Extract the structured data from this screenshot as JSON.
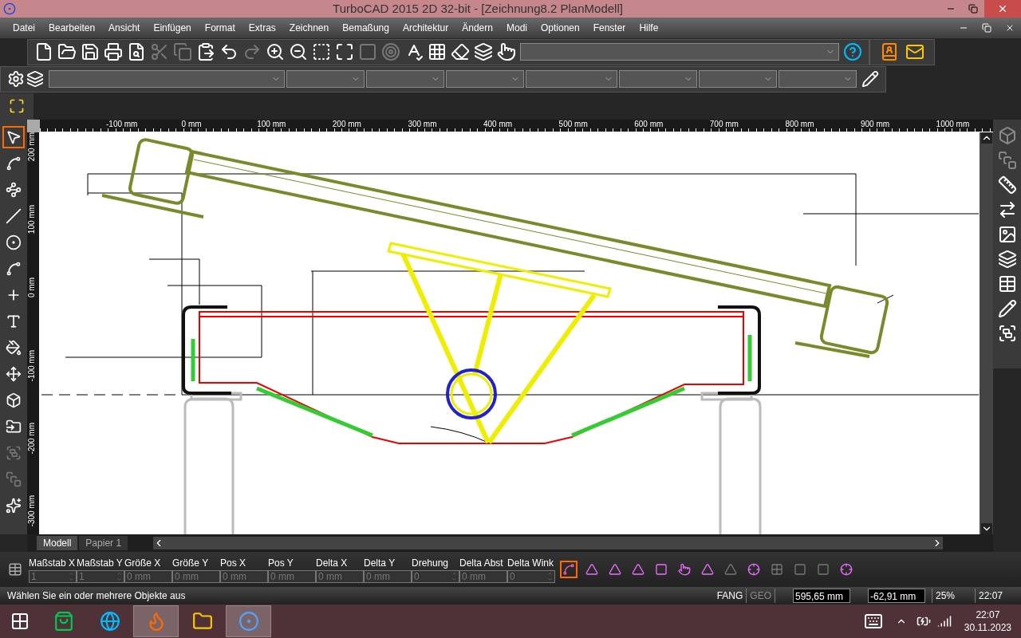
{
  "window": {
    "title": "TurboCAD 2015 2D 32-bit - [Zeichnung8.2 PlanModell]"
  },
  "menu": [
    "Datei",
    "Bearbeiten",
    "Ansicht",
    "Einfügen",
    "Format",
    "Extras",
    "Zeichnen",
    "Bemaßung",
    "Architektur",
    "Ändern",
    "Modi",
    "Optionen",
    "Fenster",
    "Hilfe"
  ],
  "toolbar": {
    "buttons": [
      {
        "disabled": false
      },
      {
        "disabled": false
      },
      {
        "disabled": false
      },
      {
        "disabled": false
      },
      {
        "disabled": false
      },
      {
        "disabled": true
      },
      {
        "disabled": true
      },
      {
        "disabled": false
      },
      {
        "disabled": false
      },
      {
        "disabled": true
      },
      {
        "disabled": false
      },
      {
        "disabled": false
      },
      {
        "disabled": false
      },
      {
        "disabled": false
      },
      {
        "disabled": true
      },
      {
        "disabled": true
      },
      {
        "disabled": false
      },
      {
        "disabled": false
      },
      {
        "disabled": false
      },
      {
        "disabled": false
      },
      {
        "disabled": false
      }
    ]
  },
  "tools": [
    {
      "selected": true,
      "disabled": false
    },
    {
      "selected": false,
      "disabled": false
    },
    {
      "selected": false,
      "disabled": false
    },
    {
      "selected": false,
      "disabled": false
    },
    {
      "selected": false,
      "disabled": false
    },
    {
      "selected": false,
      "disabled": false
    },
    {
      "selected": false,
      "disabled": false
    },
    {
      "selected": false,
      "disabled": false
    },
    {
      "selected": false,
      "disabled": false
    },
    {
      "selected": false,
      "disabled": false
    },
    {
      "selected": false,
      "disabled": false
    },
    {
      "selected": false,
      "disabled": false
    },
    {
      "selected": false,
      "disabled": true
    },
    {
      "selected": false,
      "disabled": true
    },
    {
      "selected": false,
      "disabled": false
    }
  ],
  "ruler_x": [
    "-100 mm",
    "0 mm",
    "100 mm",
    "200 mm",
    "300 mm",
    "400 mm",
    "500 mm",
    "600 mm",
    "700 mm",
    "800 mm",
    "900 mm",
    "1000 mm"
  ],
  "ruler_y": [
    "200 mm",
    "100 mm",
    "0 mm",
    "-100 mm",
    "-200 mm",
    "-300 mm"
  ],
  "sheet_tabs": [
    {
      "label": "Modell",
      "selected": true
    },
    {
      "label": "Papier 1",
      "selected": false
    }
  ],
  "inspector": [
    {
      "label": "Maßstab X",
      "value": "1",
      "spin": true
    },
    {
      "label": "Maßstab Y",
      "value": "1",
      "spin": true
    },
    {
      "label": "Größe X",
      "value": "0 mm",
      "spin": false
    },
    {
      "label": "Größe Y",
      "value": "0 mm",
      "spin": false
    },
    {
      "label": "Pos X",
      "value": "0 mm",
      "spin": false
    },
    {
      "label": "Pos Y",
      "value": "0 mm",
      "spin": false
    },
    {
      "label": "Delta X",
      "value": "0 mm",
      "spin": false
    },
    {
      "label": "Delta Y",
      "value": "0 mm",
      "spin": false
    },
    {
      "label": "Drehung",
      "value": "0",
      "spin": true
    },
    {
      "label": "Delta Abst",
      "value": "0 mm",
      "spin": false
    },
    {
      "label": "Delta Wink",
      "value": "0",
      "spin": true
    }
  ],
  "snaps": [
    {
      "selected": true,
      "disabled": false
    },
    {
      "selected": false,
      "disabled": false
    },
    {
      "selected": false,
      "disabled": false
    },
    {
      "selected": false,
      "disabled": false
    },
    {
      "selected": false,
      "disabled": false
    },
    {
      "selected": false,
      "disabled": false
    },
    {
      "selected": false,
      "disabled": false
    },
    {
      "selected": false,
      "disabled": true
    },
    {
      "selected": false,
      "disabled": false
    },
    {
      "selected": false,
      "disabled": true
    },
    {
      "selected": false,
      "disabled": true
    },
    {
      "selected": false,
      "disabled": true
    },
    {
      "selected": false,
      "disabled": false
    }
  ],
  "status_bar": {
    "message": "Wählen Sie ein oder mehrere Objekte aus",
    "modes": [
      {
        "label": "FANG",
        "on": true
      },
      {
        "label": "GEO",
        "on": false
      }
    ],
    "x": "595,65 mm",
    "y": "-62,91 mm",
    "zoom": "25%",
    "time": "22:07"
  },
  "taskbar": {
    "apps": [
      {
        "active": false
      },
      {
        "active": false
      },
      {
        "active": true
      },
      {
        "active": false
      },
      {
        "active": true
      }
    ],
    "time": "22:07",
    "date": "30.11.2023"
  }
}
